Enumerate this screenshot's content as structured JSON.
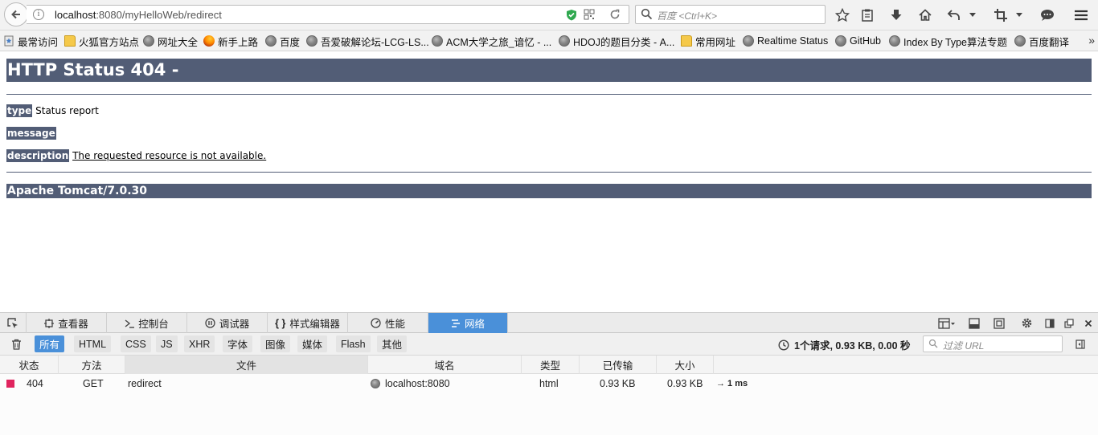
{
  "browser": {
    "url_host": "localhost",
    "url_rest": ":8080/myHelloWeb/redirect",
    "search_placeholder": "百度 <Ctrl+K>"
  },
  "bookmarks": [
    {
      "label": "最常访问",
      "icon": "bookmark-star-icon"
    },
    {
      "label": "火狐官方站点",
      "icon": "folder-icon"
    },
    {
      "label": "网址大全",
      "icon": "globe-icon"
    },
    {
      "label": "新手上路",
      "icon": "firefox-icon"
    },
    {
      "label": "百度",
      "icon": "globe-icon"
    },
    {
      "label": "吾爱破解论坛-LCG-LS...",
      "icon": "globe-icon"
    },
    {
      "label": "ACM大学之旅_谙忆 - ...",
      "icon": "globe-icon"
    },
    {
      "label": "HDOJ的题目分类 - A...",
      "icon": "globe-icon"
    },
    {
      "label": "常用网址",
      "icon": "folder-icon"
    },
    {
      "label": "Realtime Status",
      "icon": "globe-icon"
    },
    {
      "label": "GitHub",
      "icon": "globe-icon"
    },
    {
      "label": "Index By Type算法专题",
      "icon": "globe-icon"
    },
    {
      "label": "百度翻译",
      "icon": "globe-icon"
    }
  ],
  "page": {
    "title": "HTTP Status 404 -",
    "type_label": "type",
    "type_value": "Status report",
    "message_label": "message",
    "description_label": "description",
    "description_value": "The requested resource is not available.",
    "footer": "Apache Tomcat/7.0.30"
  },
  "devtools": {
    "tabs": [
      {
        "label": "查看器",
        "icon": "inspector-icon"
      },
      {
        "label": "控制台",
        "icon": "console-icon"
      },
      {
        "label": "调试器",
        "icon": "debugger-icon"
      },
      {
        "label": "样式编辑器",
        "icon": "style-editor-icon"
      },
      {
        "label": "性能",
        "icon": "performance-icon"
      },
      {
        "label": "网络",
        "icon": "network-icon",
        "active": true
      }
    ],
    "filters": [
      "所有",
      "HTML",
      "CSS",
      "JS",
      "XHR",
      "字体",
      "图像",
      "媒体",
      "Flash",
      "其他"
    ],
    "summary": "1个请求, 0.93 KB, 0.00 秒",
    "filter_url_placeholder": "过滤 URL",
    "columns": [
      "状态",
      "方法",
      "文件",
      "域名",
      "类型",
      "已传输",
      "大小"
    ],
    "requests": [
      {
        "status": "404",
        "method": "GET",
        "file": "redirect",
        "domain": "localhost:8080",
        "type": "html",
        "transferred": "0.93 KB",
        "size": "0.93 KB",
        "timing": "→ 1 ms"
      }
    ]
  },
  "colors": {
    "tomcat_header": "#525d76",
    "devtools_active": "#4a90d9",
    "status_error": "#e0245e"
  }
}
